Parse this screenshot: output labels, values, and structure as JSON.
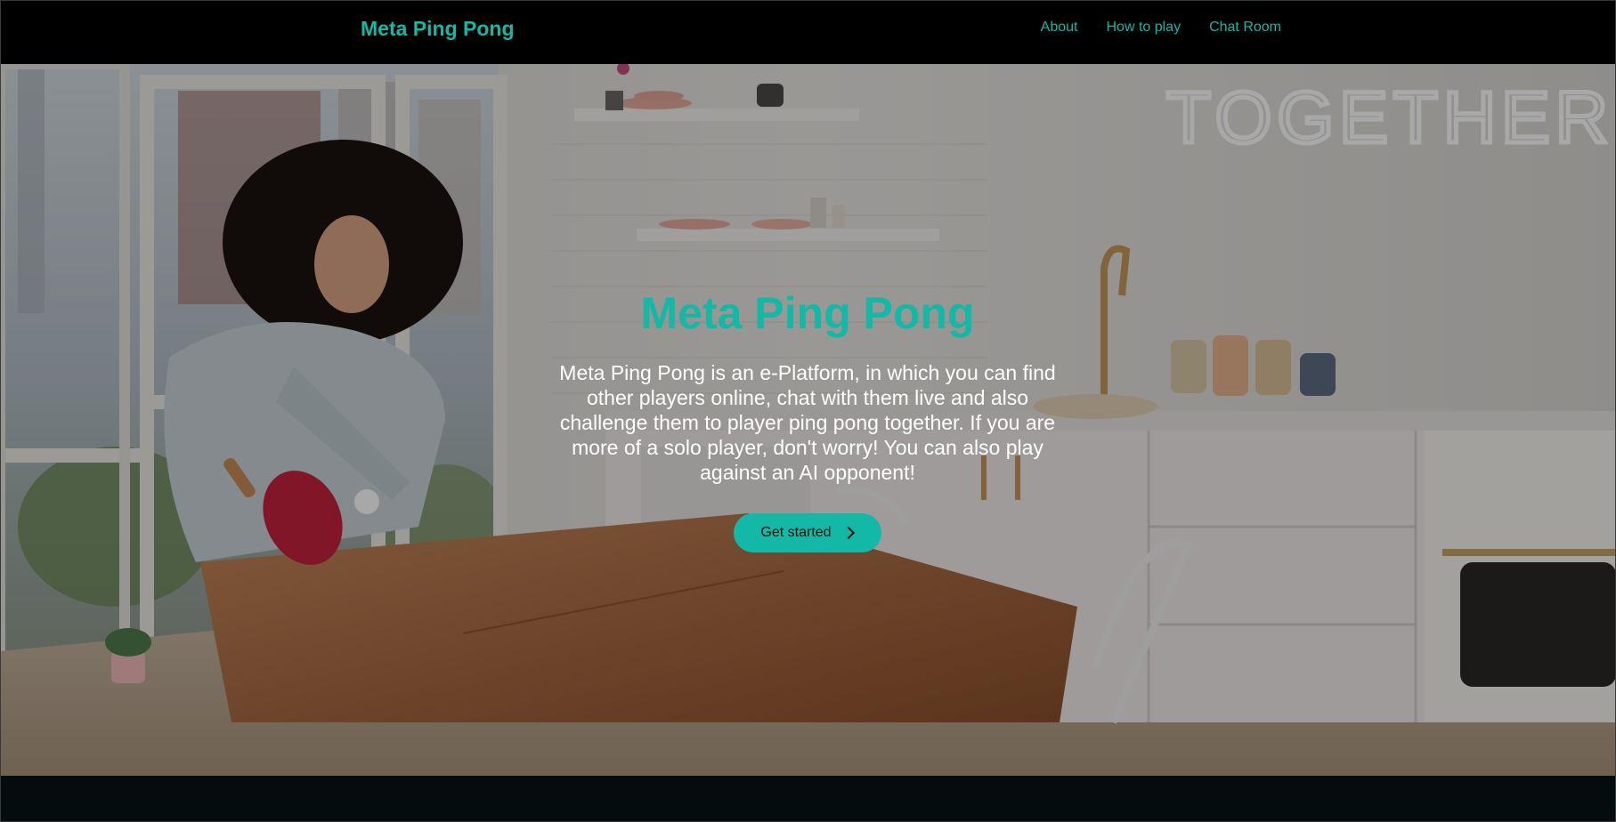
{
  "nav": {
    "brand": "Meta Ping Pong",
    "links": [
      "About",
      "How to play",
      "Chat Room"
    ]
  },
  "hero": {
    "title": "Meta Ping Pong",
    "description": "Meta Ping Pong is an e-Platform, in which you can find other players online, chat with them live and also challenge them to player ping pong together. If you are more of a solo player, don't worry! You can also play against an AI opponent!",
    "cta_label": "Get started",
    "cta_icon": "chevron-right-icon",
    "background_sign": "TOGETHER"
  },
  "colors": {
    "accent": "#14b8a6",
    "navbar_bg": "#000000",
    "page_bg": "#050c0d",
    "text_light": "#ffffff"
  }
}
